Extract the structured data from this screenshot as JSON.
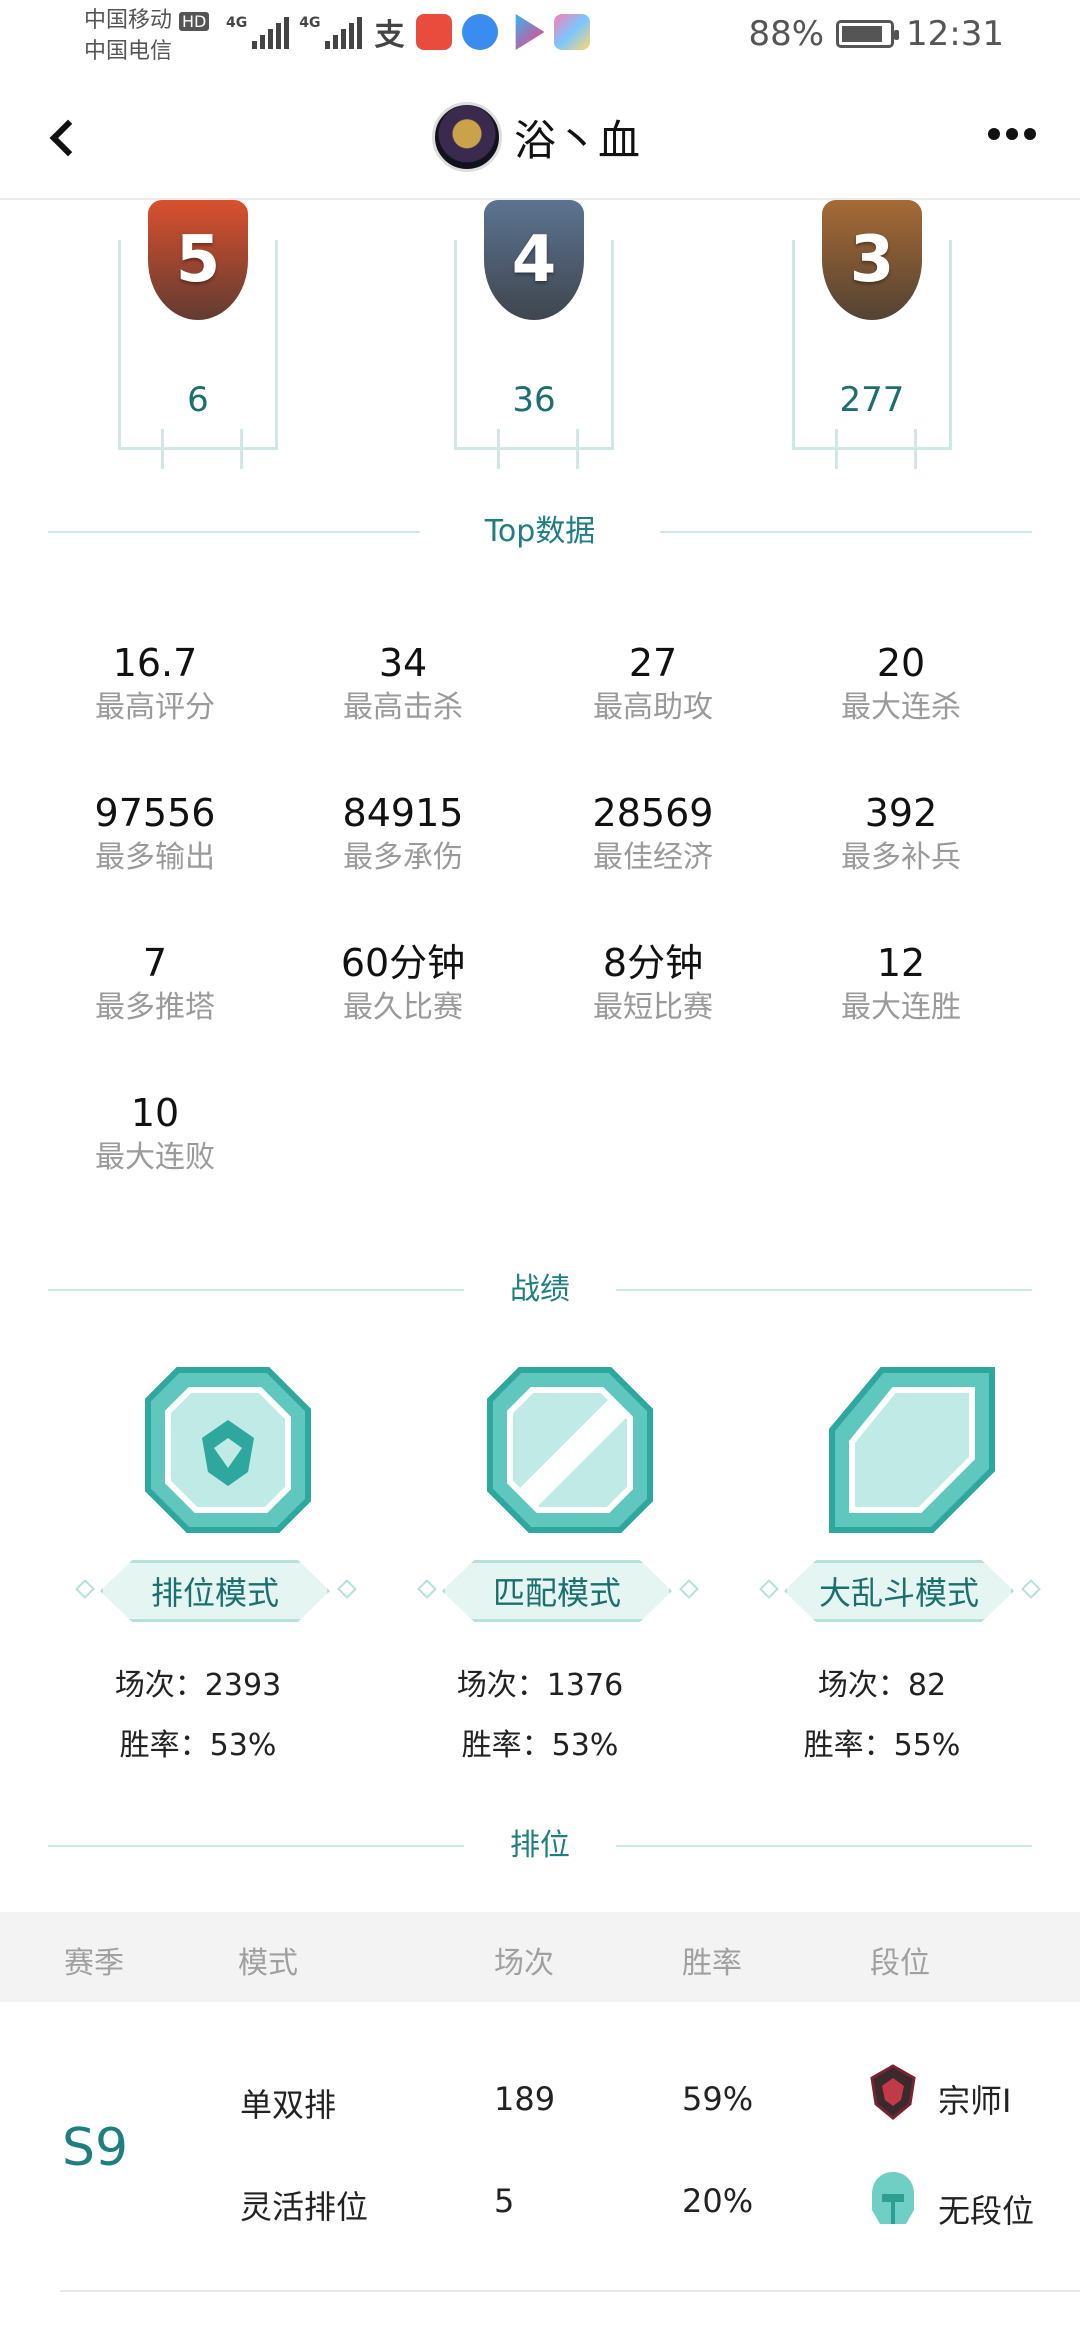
{
  "status_bar": {
    "carrier_1": "中国移动",
    "carrier_1_badge": "HD",
    "carrier_2": "中国电信",
    "signal_1_label": "4G",
    "signal_2_label": "4G",
    "app_icons": [
      "alipay-icon",
      "toutiao-icon",
      "browser-icon",
      "youku-icon",
      "photos-icon"
    ],
    "battery_percent": "88%",
    "battery_level": 0.88,
    "time": "12:31"
  },
  "header": {
    "title": "浴丶血"
  },
  "medals": [
    {
      "rank": "5",
      "count": "6",
      "color": "#d9502e"
    },
    {
      "rank": "4",
      "count": "36",
      "color": "#5c7491"
    },
    {
      "rank": "3",
      "count": "277",
      "color": "#a66a35"
    }
  ],
  "top_section": {
    "title": "Top数据",
    "stats": [
      {
        "value": "16.7",
        "label": "最高评分"
      },
      {
        "value": "34",
        "label": "最高击杀"
      },
      {
        "value": "27",
        "label": "最高助攻"
      },
      {
        "value": "20",
        "label": "最大连杀"
      },
      {
        "value": "97556",
        "label": "最多输出"
      },
      {
        "value": "84915",
        "label": "最多承伤"
      },
      {
        "value": "28569",
        "label": "最佳经济"
      },
      {
        "value": "392",
        "label": "最多补兵"
      },
      {
        "value": "7",
        "label": "最多推塔"
      },
      {
        "value": "60分钟",
        "label": "最久比赛"
      },
      {
        "value": "8分钟",
        "label": "最短比赛"
      },
      {
        "value": "12",
        "label": "最大连胜"
      },
      {
        "value": "10",
        "label": "最大连败"
      }
    ]
  },
  "record_section": {
    "title": "战绩",
    "modes": [
      {
        "name": "排位模式",
        "games": "场次：2393",
        "winrate": "胜率：53%"
      },
      {
        "name": "匹配模式",
        "games": "场次：1376",
        "winrate": "胜率：53%"
      },
      {
        "name": "大乱斗模式",
        "games": "场次：82",
        "winrate": "胜率：55%"
      }
    ]
  },
  "rank_section": {
    "title": "排位",
    "headers": [
      "赛季",
      "模式",
      "场次",
      "胜率",
      "段位"
    ],
    "season": "S9",
    "rows": [
      {
        "mode": "单双排",
        "games": "189",
        "winrate": "59%",
        "tier": "宗师I",
        "tier_icon": "grandmaster-icon"
      },
      {
        "mode": "灵活排位",
        "games": "5",
        "winrate": "20%",
        "tier": "无段位",
        "tier_icon": "unranked-icon"
      }
    ]
  },
  "colors": {
    "accent": "#1d7f7f",
    "divider": "#cde9e6",
    "label_gray": "#9a9a9a"
  }
}
